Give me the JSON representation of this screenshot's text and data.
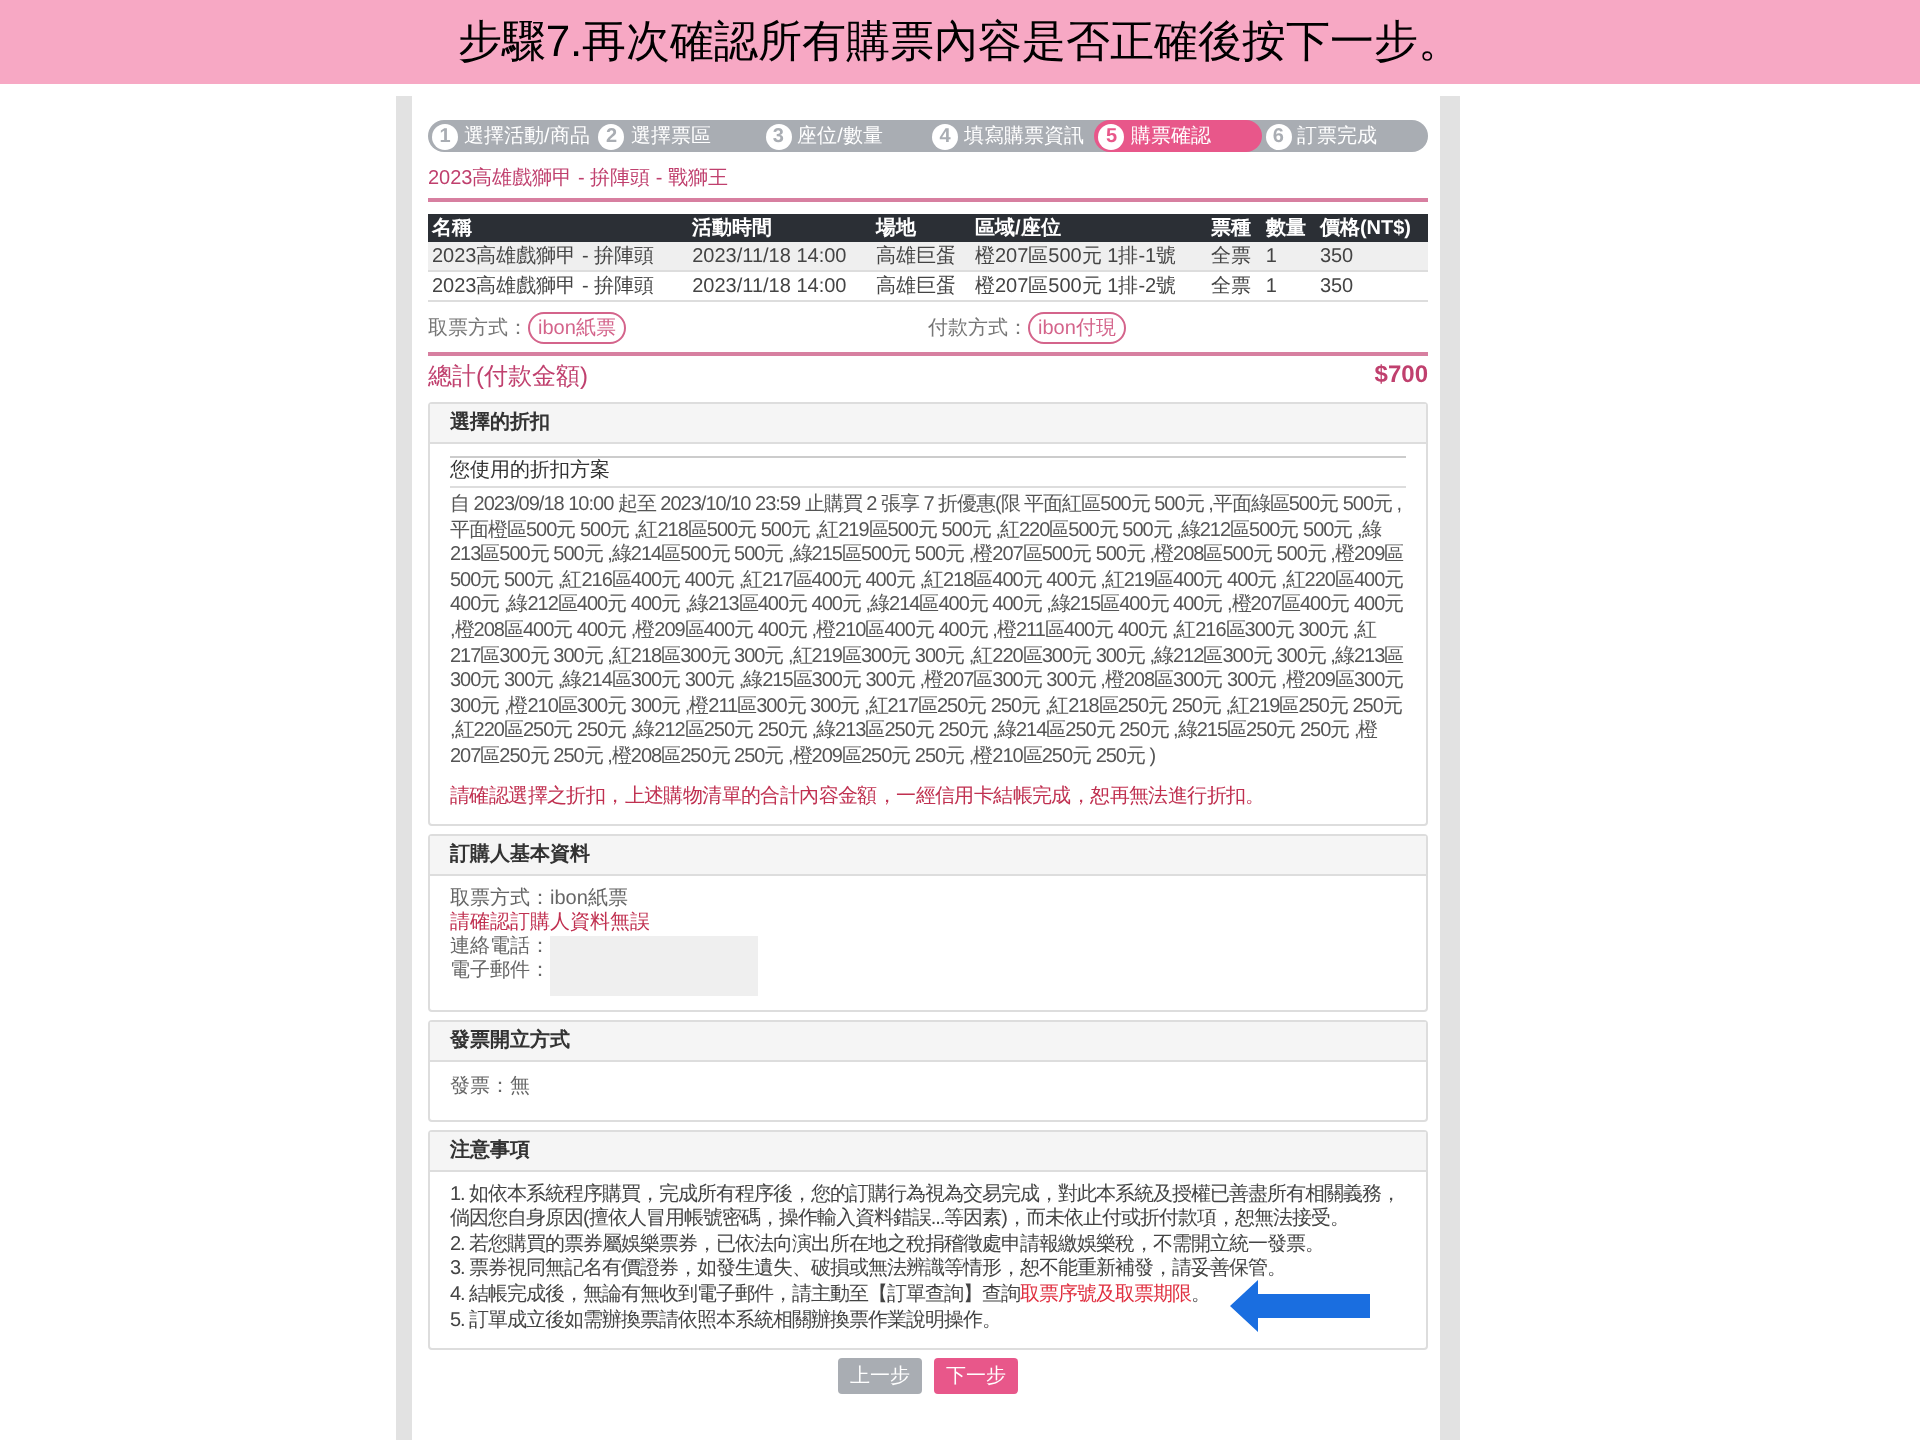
{
  "slide_title": "步驟7.再次確認所有購票內容是否正確後按下一步。",
  "steps": [
    {
      "num": "1",
      "label": "選擇活動/商品",
      "selected": false
    },
    {
      "num": "2",
      "label": "選擇票區",
      "selected": false
    },
    {
      "num": "3",
      "label": "座位/數量",
      "selected": false
    },
    {
      "num": "4",
      "label": "填寫購票資訊",
      "selected": false
    },
    {
      "num": "5",
      "label": "購票確認",
      "selected": true
    },
    {
      "num": "6",
      "label": "訂票完成",
      "selected": false
    }
  ],
  "event_title": "2023高雄戲獅甲 - 拚陣頭 - 戰獅王",
  "table": {
    "columns": [
      "名稱",
      "活動時間",
      "場地",
      "區域/座位",
      "票種",
      "數量",
      "價格(NT$)"
    ],
    "rows": [
      [
        "2023高雄戲獅甲 - 拚陣頭",
        "2023/11/18  14:00",
        "高雄巨蛋",
        "橙207區500元  1排-1號",
        "全票",
        "1",
        "350"
      ],
      [
        "2023高雄戲獅甲 - 拚陣頭",
        "2023/11/18  14:00",
        "高雄巨蛋",
        "橙207區500元  1排-2號",
        "全票",
        "1",
        "350"
      ]
    ]
  },
  "pickup": {
    "label": "取票方式：",
    "value": "ibon紙票"
  },
  "payment": {
    "label": "付款方式：",
    "value": "ibon付現"
  },
  "total": {
    "label": "總計(付款金額)",
    "amount": "$700"
  },
  "discount": {
    "heading": "選擇的折扣",
    "subheading": "您使用的折扣方案",
    "text": "自 2023/09/18 10:00 起至 2023/10/10 23:59 止購買 2 張享 7 折優惠(限 平面紅區500元 500元 ,平面綠區500元 500元 ,平面橙區500元 500元 ,紅218區500元 500元 ,紅219區500元 500元 ,紅220區500元 500元 ,綠212區500元 500元 ,綠213區500元 500元 ,綠214區500元 500元 ,綠215區500元 500元 ,橙207區500元 500元 ,橙208區500元 500元 ,橙209區500元 500元 ,紅216區400元 400元 ,紅217區400元 400元 ,紅218區400元 400元 ,紅219區400元 400元 ,紅220區400元 400元 ,綠212區400元 400元 ,綠213區400元 400元 ,綠214區400元 400元 ,綠215區400元 400元 ,橙207區400元 400元 ,橙208區400元 400元 ,橙209區400元 400元 ,橙210區400元 400元 ,橙211區400元 400元 ,紅216區300元 300元 ,紅217區300元 300元 ,紅218區300元 300元 ,紅219區300元 300元 ,紅220區300元 300元 ,綠212區300元 300元 ,綠213區300元 300元 ,綠214區300元 300元 ,綠215區300元 300元 ,橙207區300元 300元 ,橙208區300元 300元 ,橙209區300元 300元 ,橙210區300元 300元 ,橙211區300元 300元 ,紅217區250元 250元 ,紅218區250元 250元 ,紅219區250元 250元 ,紅220區250元 250元 ,綠212區250元 250元 ,綠213區250元 250元 ,綠214區250元 250元 ,綠215區250元 250元 ,橙207區250元 250元 ,橙208區250元 250元 ,橙209區250元 250元 ,橙210區250元 250元 )",
    "warning": "請確認選擇之折扣，上述購物清單的合計內容金額，一經信用卡結帳完成，恕再無法進行折扣。"
  },
  "buyer": {
    "heading": "訂購人基本資料",
    "pickup_line": "取票方式：ibon紙票",
    "warning": "請確認訂購人資料無誤",
    "fields": [
      {
        "label": "連絡電話："
      },
      {
        "label": "電子郵件："
      }
    ]
  },
  "invoice": {
    "heading": "發票開立方式",
    "text": "發票：無"
  },
  "notes": {
    "heading": "注意事項",
    "items": [
      {
        "segments": [
          {
            "text": "1. 如依本系統程序購買，完成所有程序後，您的訂購行為視為交易完成，對此本系統及授權已善盡所有相關義務，倘因您自身原因(擅依人冒用帳號密碼，操作輸入資料錯誤...等因素)，而未依止付或折付款項，恕無法接受。",
            "highlight": false
          }
        ]
      },
      {
        "segments": [
          {
            "text": "2. 若您購買的票券屬娛樂票券，已依法向演出所在地之稅捐稽徵處申請報繳娛樂稅，不需開立統一發票。",
            "highlight": false
          }
        ]
      },
      {
        "segments": [
          {
            "text": "3. 票券視同無記名有價證券，如發生遺失、破損或無法辨識等情形，恕不能重新補發，請妥善保管。",
            "highlight": false
          }
        ]
      },
      {
        "segments": [
          {
            "text": "4. 結帳完成後，無論有無收到電子郵件，請主動至【訂單查詢】查詢",
            "highlight": false
          },
          {
            "text": "取票序號及取票期限",
            "highlight": true
          },
          {
            "text": "。",
            "highlight": false
          }
        ]
      },
      {
        "segments": [
          {
            "text": "5. 訂單成立後如需辦換票請依照本系統相關辦換票作業說明操作。",
            "highlight": false
          }
        ]
      }
    ]
  },
  "buttons": [
    {
      "label": "上一步",
      "kind": "back"
    },
    {
      "label": "下一步",
      "kind": "next"
    }
  ]
}
